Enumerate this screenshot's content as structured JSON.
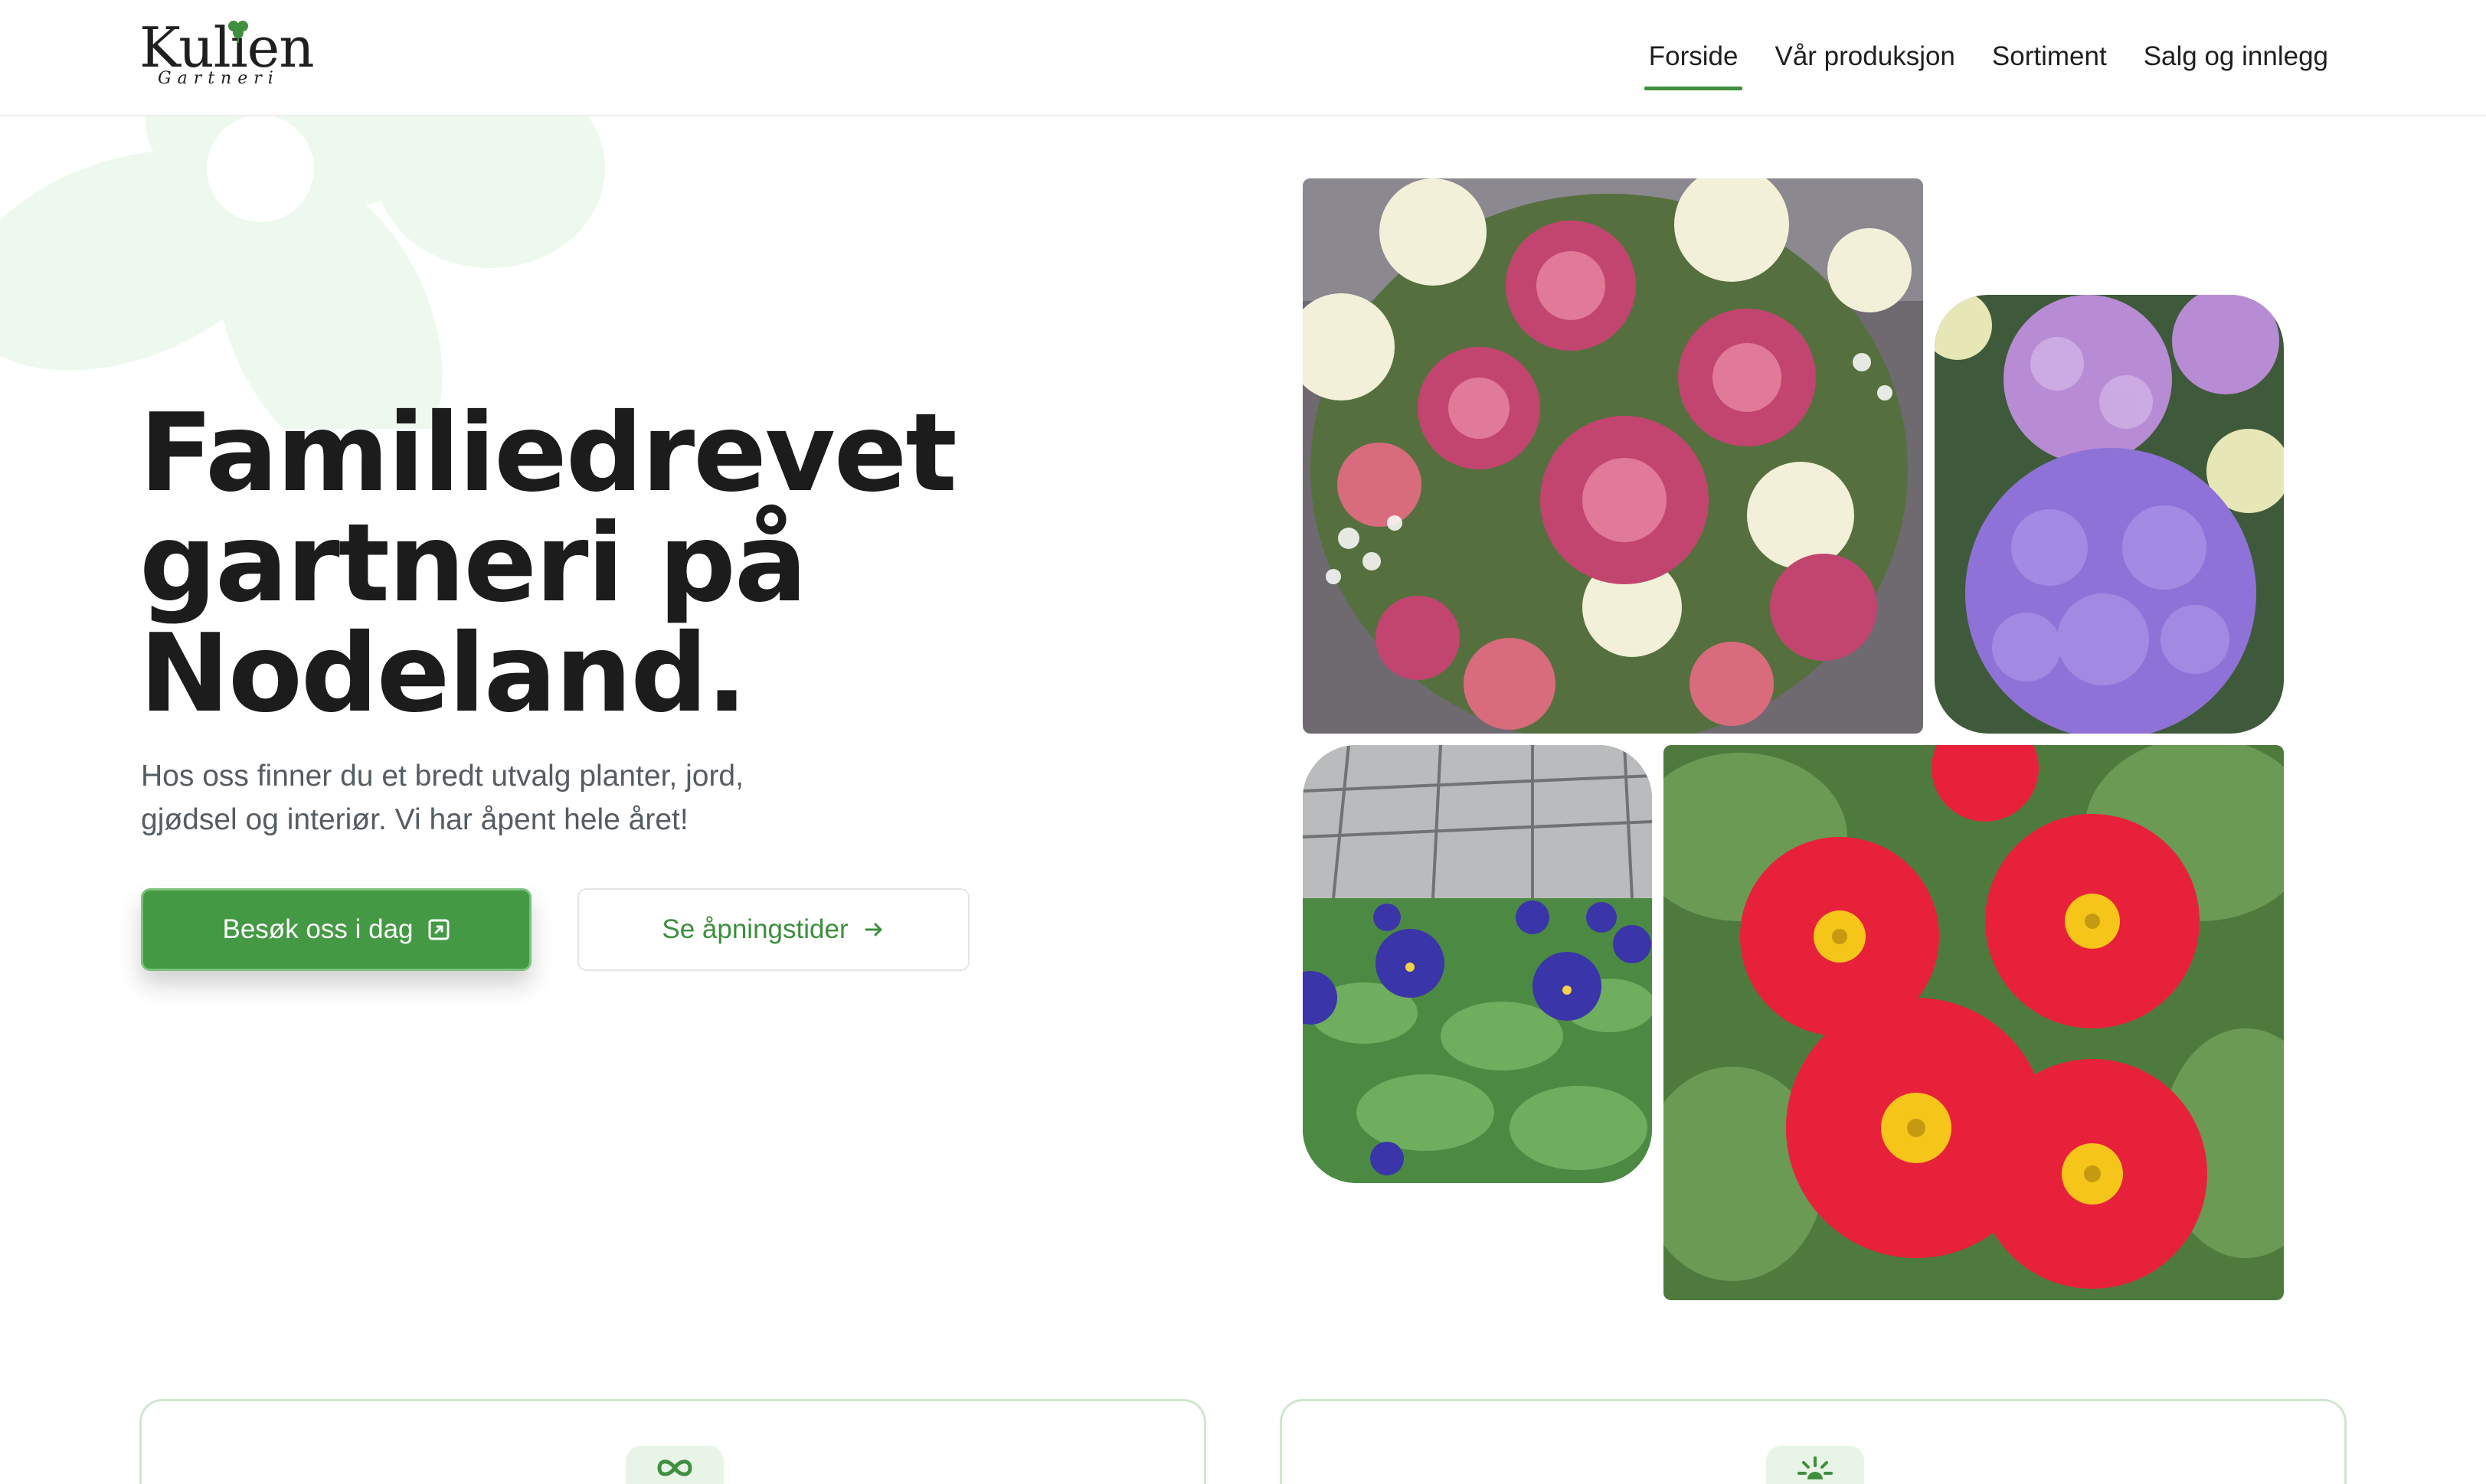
{
  "brand": {
    "name": "Kulien",
    "subtitle": "Gartneri"
  },
  "nav": {
    "items": [
      {
        "label": "Forside",
        "active": true
      },
      {
        "label": "Vår produksjon",
        "active": false
      },
      {
        "label": "Sortiment",
        "active": false
      },
      {
        "label": "Salg og innlegg",
        "active": false
      }
    ]
  },
  "hero": {
    "title_line1": "Familiedrevet",
    "title_line2": "gartneri på",
    "title_line3": "Nodeland.",
    "subtitle_line1": "Hos oss finner du et bredt utvalg planter, jord,",
    "subtitle_line2": "gjødsel og interiør. Vi har åpent hele året!",
    "primary_button": "Besøk oss i dag",
    "secondary_button": "Se åpningstider"
  },
  "icons": {
    "primary_button": "external-link-icon",
    "secondary_button": "arrow-right-icon",
    "card1": "infinity-icon",
    "card2": "sun-icon",
    "logo": "clover-icon"
  },
  "colors": {
    "accent": "#449944",
    "accent_text": "#3d8e3d",
    "deco": "#edf8ee",
    "card_border": "#cfe6cf"
  }
}
